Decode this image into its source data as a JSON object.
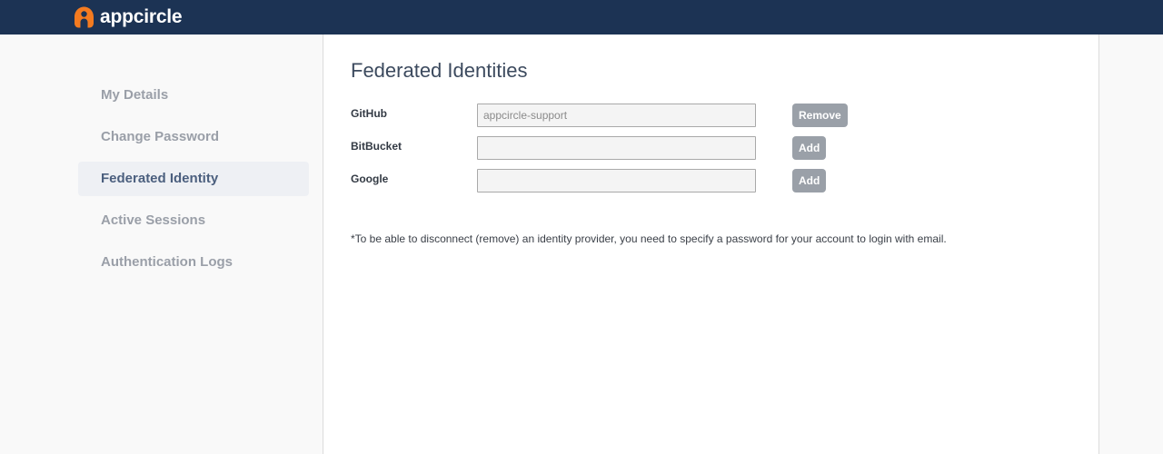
{
  "brand": {
    "name": "appcircle",
    "icon": "appcircle-logo-icon",
    "color": "#f47b20"
  },
  "topbar": {
    "background": "#1c3354"
  },
  "sidebar": {
    "items": [
      {
        "label": "My Details",
        "active": false
      },
      {
        "label": "Change Password",
        "active": false
      },
      {
        "label": "Federated Identity",
        "active": true
      },
      {
        "label": "Active Sessions",
        "active": false
      },
      {
        "label": "Authentication Logs",
        "active": false
      }
    ]
  },
  "main": {
    "title": "Federated Identities",
    "rows": [
      {
        "label": "GitHub",
        "value": "appcircle-support",
        "button": "Remove"
      },
      {
        "label": "BitBucket",
        "value": "",
        "button": "Add"
      },
      {
        "label": "Google",
        "value": "",
        "button": "Add"
      }
    ],
    "note": "*To be able to disconnect (remove) an identity provider, you need to specify a password for your account to login with email."
  }
}
